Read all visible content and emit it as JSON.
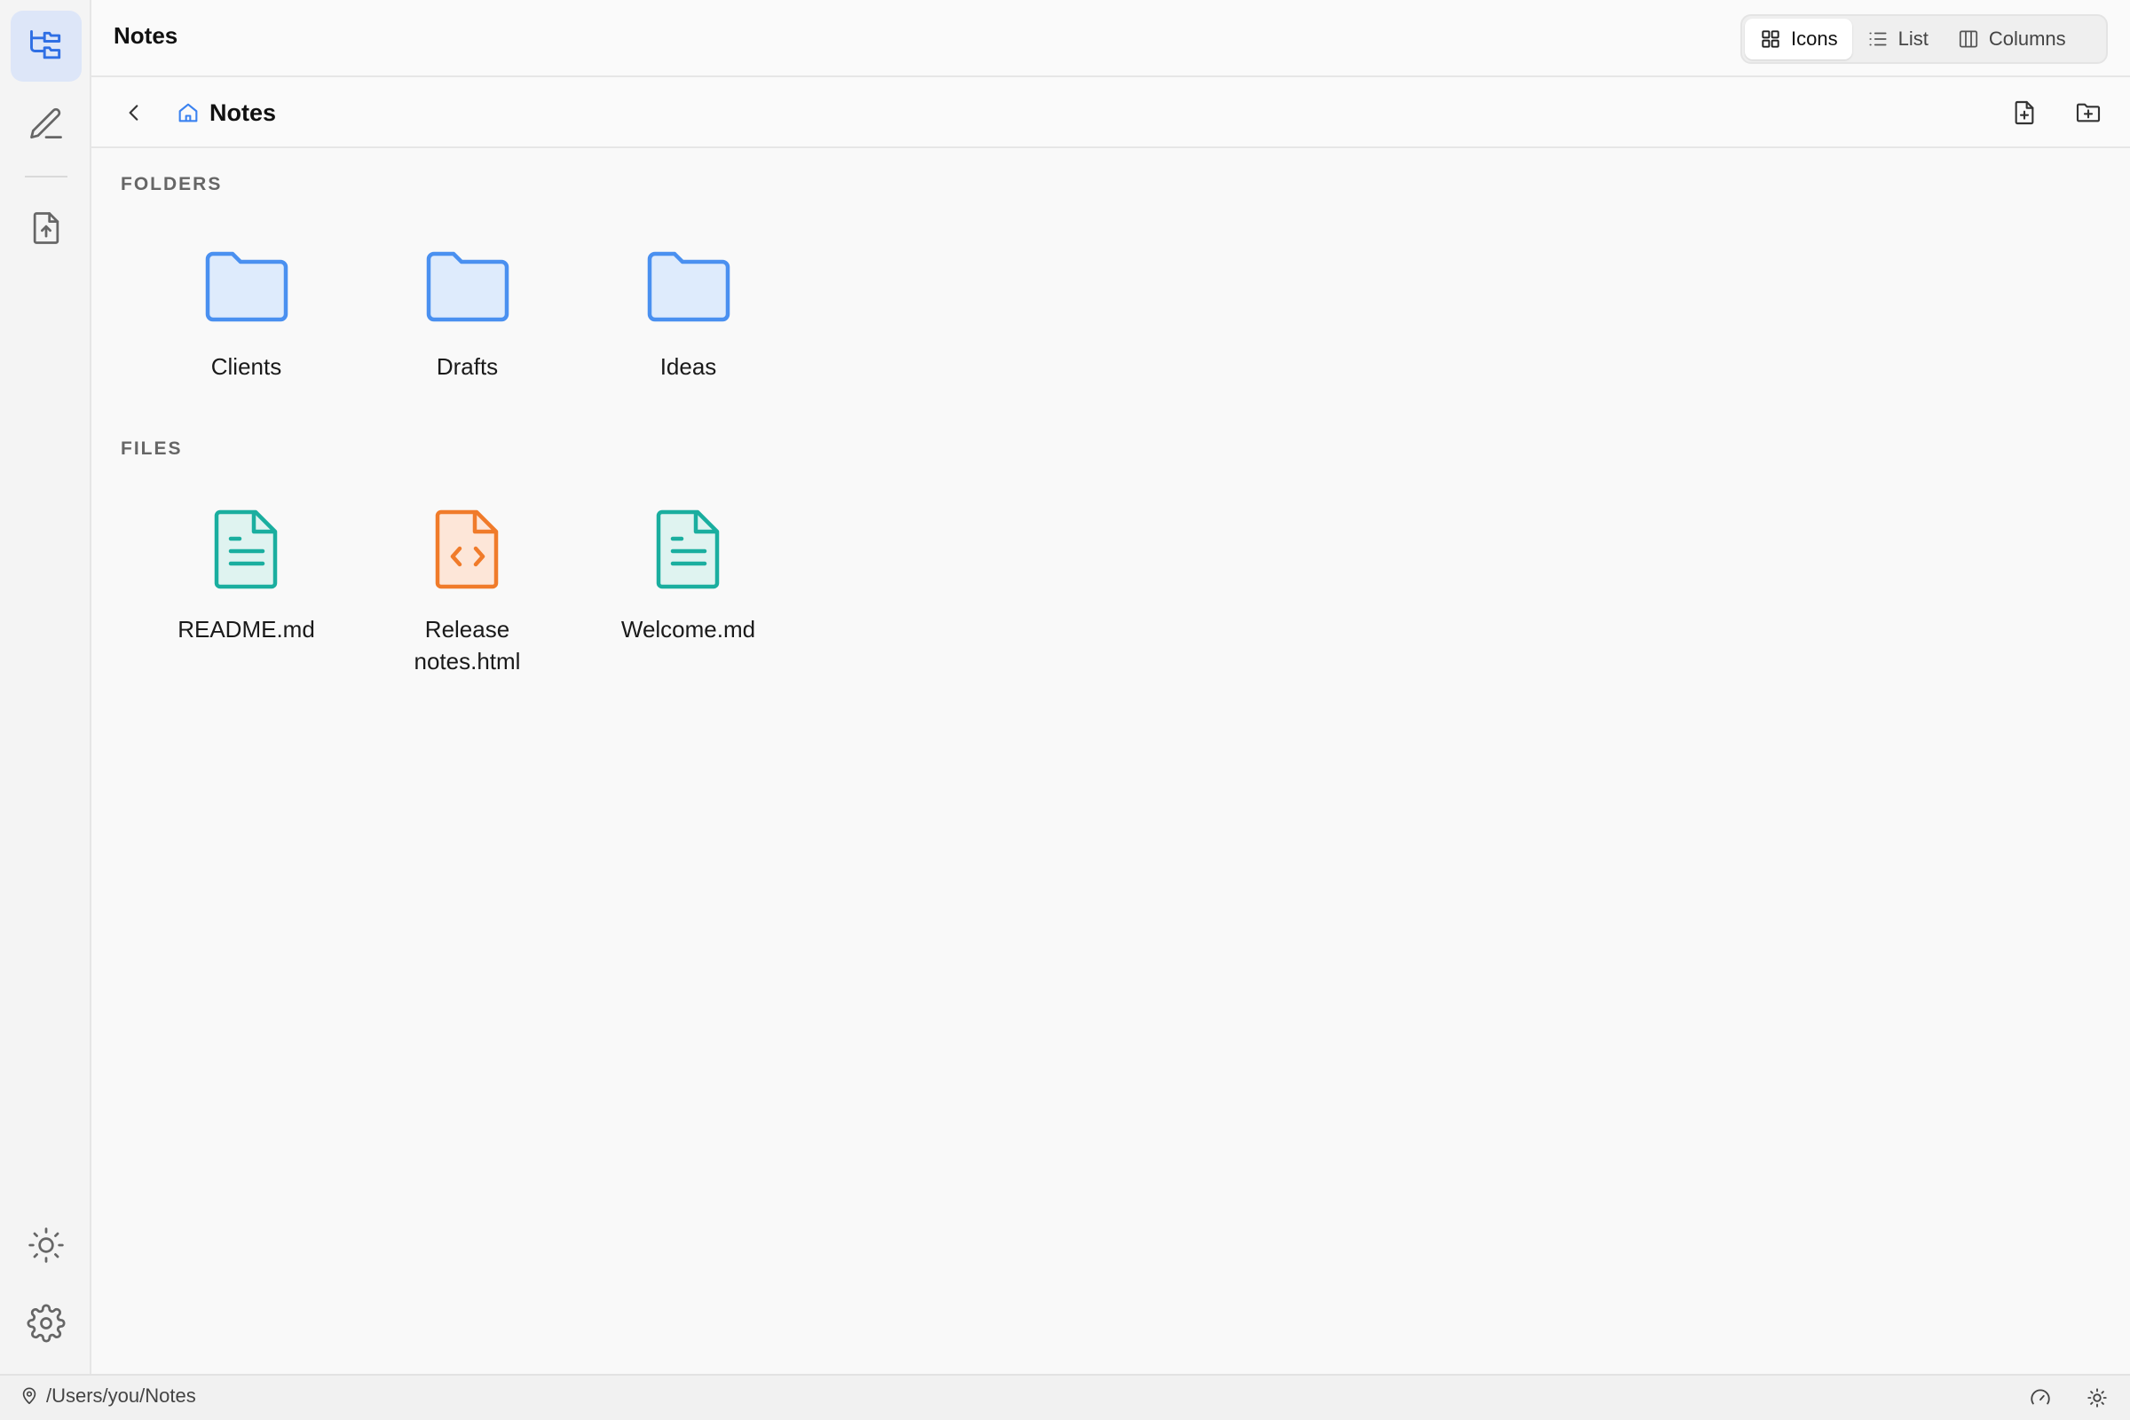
{
  "app": {
    "title": "Notes"
  },
  "view_switch": {
    "options": [
      {
        "label": "Icons",
        "icon": "grid-icon",
        "active": true
      },
      {
        "label": "List",
        "icon": "list-icon",
        "active": false
      },
      {
        "label": "Columns",
        "icon": "columns-icon",
        "active": false
      }
    ]
  },
  "rail": {
    "items": [
      {
        "name": "explorer",
        "icon": "folder-tree-icon",
        "active": true
      },
      {
        "name": "editor",
        "icon": "pencil-icon",
        "active": false
      },
      {
        "name": "import",
        "icon": "file-upload-icon",
        "active": false
      }
    ],
    "bottom": [
      {
        "name": "theme",
        "icon": "sun-icon"
      },
      {
        "name": "settings",
        "icon": "gear-icon"
      }
    ]
  },
  "breadcrumb": {
    "label": "Notes",
    "icon": "home-icon"
  },
  "actions": {
    "new_file_icon": "file-plus-icon",
    "new_folder_icon": "folder-plus-icon"
  },
  "sections": {
    "folders_title": "FOLDERS",
    "files_title": "FILES"
  },
  "folders": [
    {
      "name": "Clients"
    },
    {
      "name": "Drafts"
    },
    {
      "name": "Ideas"
    }
  ],
  "files": [
    {
      "name": "README.md",
      "kind": "markdown"
    },
    {
      "name": "Release notes.html",
      "kind": "html"
    },
    {
      "name": "Welcome.md",
      "kind": "markdown"
    }
  ],
  "status": {
    "path": "/Users/you/Notes"
  },
  "colors": {
    "accent": "#2f6fe4",
    "folder_stroke": "#4a90f0",
    "folder_fill": "#deebfc",
    "md_stroke": "#1aae9f",
    "md_fill": "#dff3f0",
    "html_stroke": "#f07b2a",
    "html_fill": "#fde6d8"
  }
}
